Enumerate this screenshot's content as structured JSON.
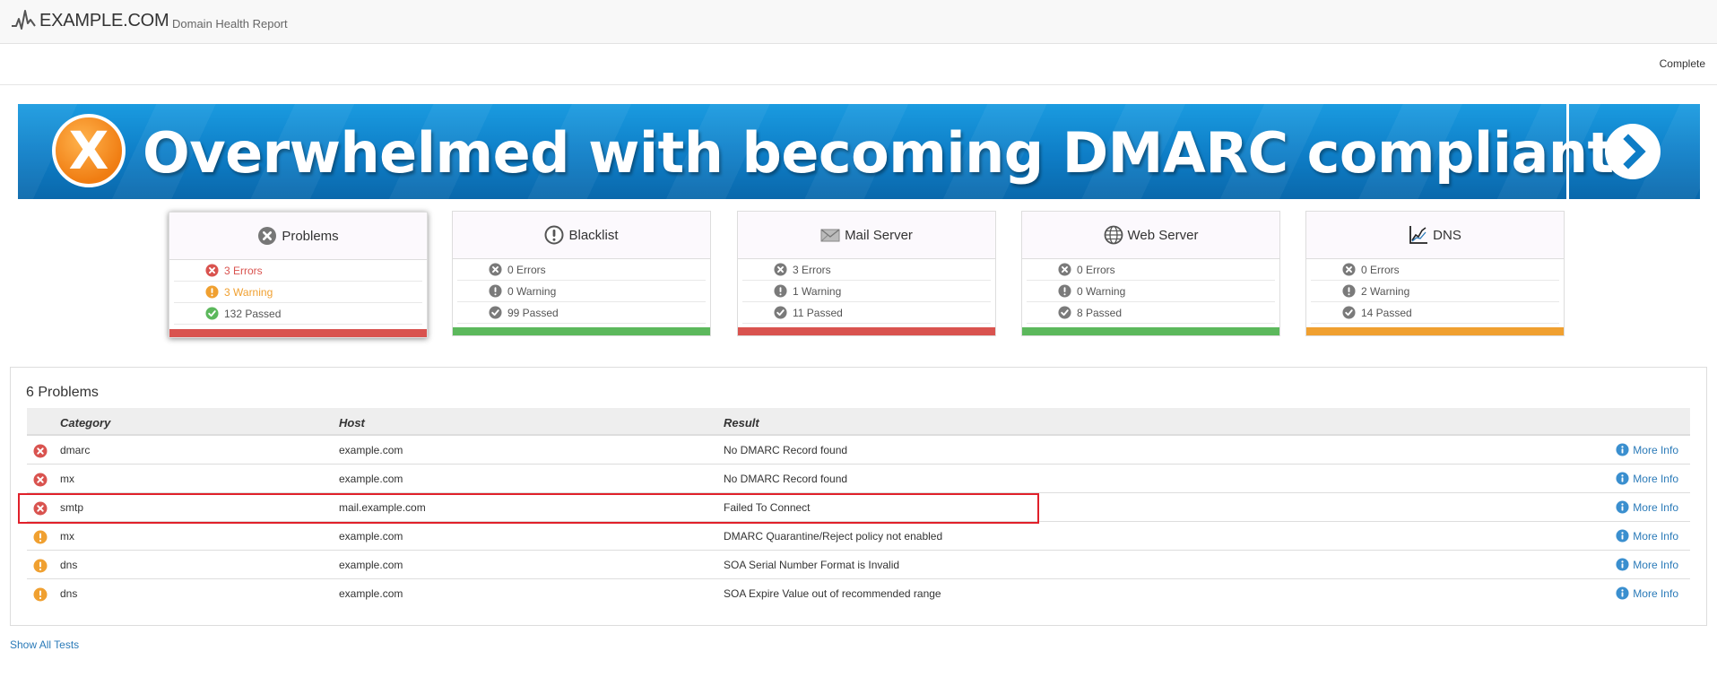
{
  "header": {
    "brand": "EXAMPLE.COM",
    "subtitle": "Domain Health Report",
    "logo_icon": "heartbeat-logo-icon"
  },
  "status": {
    "label": "Complete"
  },
  "banner": {
    "icon_letter": "X",
    "text": "Overwhelmed with becoming DMARC compliant?"
  },
  "colors": {
    "error": "#d9534f",
    "warning": "#f0a030",
    "pass": "#5cb85c",
    "link": "#2a7ab8"
  },
  "cards": [
    {
      "title": "Problems",
      "icon": "x-circle-icon",
      "errors": "3 Errors",
      "warnings": "3 Warning",
      "passed": "132 Passed",
      "bar_color": "#d9534f"
    },
    {
      "title": "Blacklist",
      "icon": "exclamation-circle-icon",
      "errors": "0 Errors",
      "warnings": "0 Warning",
      "passed": "99 Passed",
      "bar_color": "#5cb85c"
    },
    {
      "title": "Mail Server",
      "icon": "envelope-icon",
      "errors": "3 Errors",
      "warnings": "1 Warning",
      "passed": "11 Passed",
      "bar_color": "#d9534f"
    },
    {
      "title": "Web Server",
      "icon": "globe-icon",
      "errors": "0 Errors",
      "warnings": "0 Warning",
      "passed": "8 Passed",
      "bar_color": "#5cb85c"
    },
    {
      "title": "DNS",
      "icon": "chart-icon",
      "errors": "0 Errors",
      "warnings": "2 Warning",
      "passed": "14 Passed",
      "bar_color": "#f0a030"
    }
  ],
  "problems": {
    "title": "6 Problems",
    "columns": [
      "Category",
      "Host",
      "Result"
    ],
    "rows": [
      {
        "severity": "error",
        "category": "dmarc",
        "host": "example.com",
        "result": "No DMARC Record found",
        "action": "More Info"
      },
      {
        "severity": "error",
        "category": "mx",
        "host": "example.com",
        "result": "No DMARC Record found",
        "action": "More Info"
      },
      {
        "severity": "error",
        "category": "smtp",
        "host": "mail.example.com",
        "result": "Failed To Connect",
        "action": "More Info"
      },
      {
        "severity": "warning",
        "category": "mx",
        "host": "example.com",
        "result": "DMARC Quarantine/Reject policy not enabled",
        "action": "More Info"
      },
      {
        "severity": "warning",
        "category": "dns",
        "host": "example.com",
        "result": "SOA Serial Number Format is Invalid",
        "action": "More Info"
      },
      {
        "severity": "warning",
        "category": "dns",
        "host": "example.com",
        "result": "SOA Expire Value out of recommended range",
        "action": "More Info"
      }
    ]
  },
  "footer": {
    "show_all": "Show All Tests"
  }
}
